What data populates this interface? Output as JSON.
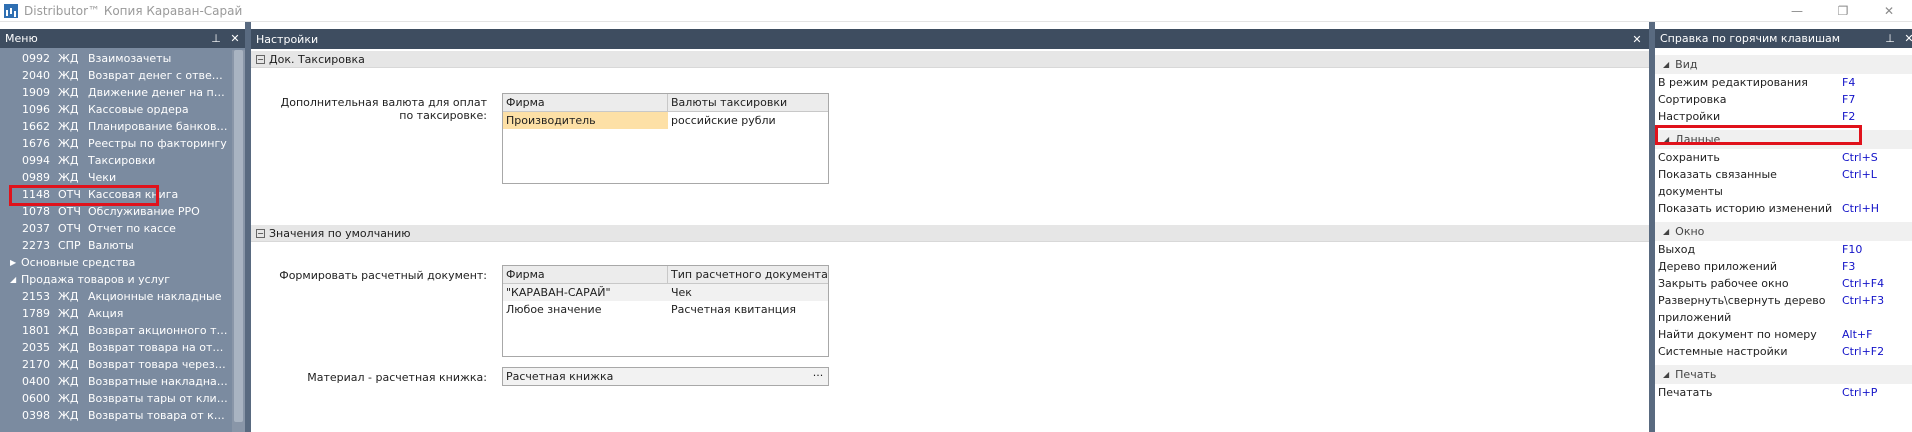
{
  "window": {
    "title": "Distributor™ Копия Караван-Сарай",
    "minimize": "—",
    "restore": "❐",
    "close": "✕"
  },
  "menu_panel": {
    "title": "Меню",
    "pin": "⊥",
    "close": "✕",
    "items": [
      {
        "code": "0992",
        "type": "ЖД",
        "name": "Взаимозачеты"
      },
      {
        "code": "2040",
        "type": "ЖД",
        "name": "Возврат денег с ответ.х..."
      },
      {
        "code": "1909",
        "type": "ЖД",
        "name": "Движение денег на плас..."
      },
      {
        "code": "1096",
        "type": "ЖД",
        "name": "Кассовые ордера"
      },
      {
        "code": "1662",
        "type": "ЖД",
        "name": "Планирование банковск..."
      },
      {
        "code": "1676",
        "type": "ЖД",
        "name": "Реестры по факторингу"
      },
      {
        "code": "0994",
        "type": "ЖД",
        "name": "Таксировки"
      },
      {
        "code": "0989",
        "type": "ЖД",
        "name": "Чеки"
      },
      {
        "code": "1148",
        "type": "ОТЧ",
        "name": "Кассовая книга"
      },
      {
        "code": "1078",
        "type": "ОТЧ",
        "name": "Обслуживание РРО"
      },
      {
        "code": "2037",
        "type": "ОТЧ",
        "name": "Отчет по кассе"
      },
      {
        "code": "2273",
        "type": "СПР",
        "name": "Валюты"
      }
    ],
    "group_collapsed": "Основные средства",
    "group_expanded": "Продажа товаров и услуг",
    "items2": [
      {
        "code": "2153",
        "type": "ЖД",
        "name": "Акционные накладные"
      },
      {
        "code": "1789",
        "type": "ЖД",
        "name": "Акция"
      },
      {
        "code": "1801",
        "type": "ЖД",
        "name": "Возврат акционного тов..."
      },
      {
        "code": "2035",
        "type": "ЖД",
        "name": "Возврат товара на отве..."
      },
      {
        "code": "2170",
        "type": "ЖД",
        "name": "Возврат товара через со..."
      },
      {
        "code": "0400",
        "type": "ЖД",
        "name": "Возвратные накладная ..."
      },
      {
        "code": "0600",
        "type": "ЖД",
        "name": "Возвраты тары от клиен..."
      },
      {
        "code": "0398",
        "type": "ЖД",
        "name": "Возвраты товара от кли..."
      }
    ]
  },
  "settings_panel": {
    "title": "Настройки",
    "close": "✕",
    "section1": {
      "title": "Док. Таксировка",
      "collapse": "⊟",
      "field_label": "Дополнительная валюта для оплат по таксировке:",
      "columns": [
        "Фирма",
        "Валюты таксировки"
      ],
      "rows": [
        [
          "Производитель",
          "российские рубли"
        ]
      ]
    },
    "section2": {
      "title": "Значения по умолчанию",
      "collapse": "⊟",
      "field_label": "Формировать расчетный документ:",
      "columns": [
        "Фирма",
        "Тип расчетного документа"
      ],
      "rows": [
        [
          "\"КАРАВАН-САРАЙ\"",
          "Чек"
        ],
        [
          "Любое значение",
          "Расчетная квитанция"
        ]
      ],
      "material_label": "Материал - расчетная книжка:",
      "material_value": "Расчетная книжка",
      "material_btn": "···"
    }
  },
  "hotkeys_panel": {
    "title": "Справка по горячим клавишам",
    "pin": "⊥",
    "close": "✕",
    "groups": [
      {
        "name": "Вид",
        "items": [
          {
            "action": "В режим редактирования",
            "key": "F4"
          },
          {
            "action": "Сортировка",
            "key": "F7"
          },
          {
            "action": "Настройки",
            "key": "F2"
          }
        ]
      },
      {
        "name": "Данные",
        "items": [
          {
            "action": "Сохранить",
            "key": "Ctrl+S"
          },
          {
            "action": "Показать связанные документы",
            "key": "Ctrl+L"
          },
          {
            "action": "Показать историю изменений",
            "key": "Ctrl+H"
          }
        ]
      },
      {
        "name": "Окно",
        "items": [
          {
            "action": "Выход",
            "key": "F10"
          },
          {
            "action": "Дерево приложений",
            "key": "F3"
          },
          {
            "action": "Закрыть рабочее окно",
            "key": "Ctrl+F4"
          },
          {
            "action": "Развернуть\\свернуть дерево приложений",
            "key": "Ctrl+F3"
          },
          {
            "action": "Найти документ по номеру",
            "key": "Alt+F"
          },
          {
            "action": "Системные настройки",
            "key": "Ctrl+F2"
          }
        ]
      },
      {
        "name": "Печать",
        "items": [
          {
            "action": "Печатать",
            "key": "Ctrl+P"
          }
        ]
      }
    ]
  },
  "colors": {
    "highlight_box": "#e0121b",
    "panel_header": "#3e4d60",
    "menu_bg": "#7b8ba0",
    "hotkey_text": "#1313c8",
    "selected_row": "#fde0a6"
  }
}
